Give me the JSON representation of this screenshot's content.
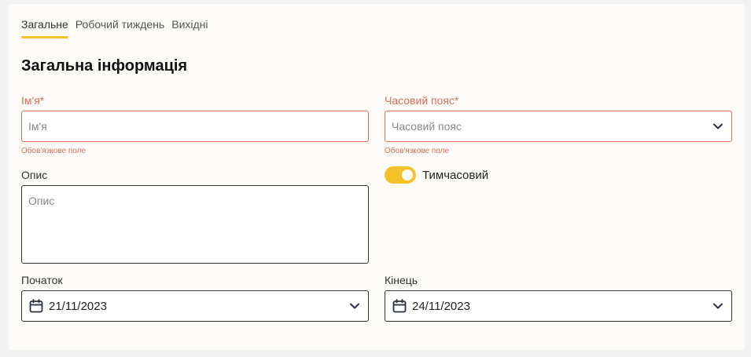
{
  "tabs": [
    {
      "label": "Загальне",
      "active": true
    },
    {
      "label": "Робочий тиждень",
      "active": false
    },
    {
      "label": "Вихідні",
      "active": false
    }
  ],
  "section_title": "Загальна інформація",
  "name_field": {
    "label": "Ім'я*",
    "placeholder": "Ім'я",
    "helper": "Обов'язкове поле"
  },
  "timezone_field": {
    "label": "Часовий пояс*",
    "placeholder": "Часовий пояс",
    "helper": "Обов'язкове поле"
  },
  "description_field": {
    "label": "Опис",
    "placeholder": "Опис"
  },
  "temporary_toggle": {
    "label": "Тимчасовий",
    "on": true
  },
  "start_field": {
    "label": "Початок",
    "value": "21/11/2023"
  },
  "end_field": {
    "label": "Кінець",
    "value": "24/11/2023"
  },
  "colors": {
    "accent": "#f4c22b",
    "error": "#dd6f5a",
    "border": "#333333"
  },
  "icons": {
    "dropdown": "chevron-down-icon",
    "date": "calendar-icon"
  }
}
